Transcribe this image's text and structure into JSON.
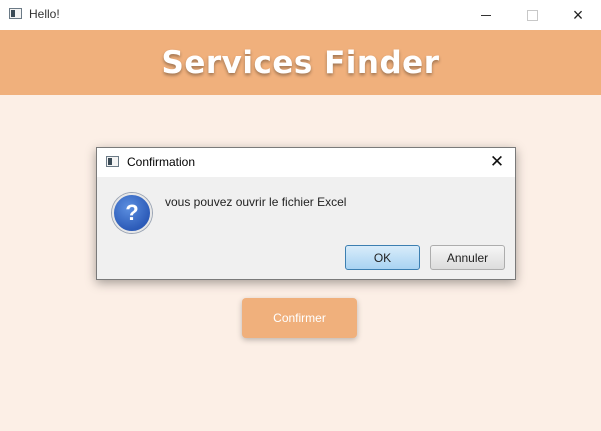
{
  "window": {
    "title": "Hello!",
    "controls": {
      "minimize": "minimize-icon",
      "maximize": "maximize-icon",
      "close": "×"
    }
  },
  "header": {
    "title": "Services Finder",
    "background": "#f0b07c",
    "text_color": "#ffffff"
  },
  "body": {
    "background": "#fcefe6",
    "confirm_label": "Confirmer"
  },
  "dialog": {
    "title": "Confirmation",
    "close": "✕",
    "icon": "question-icon",
    "icon_glyph": "?",
    "message": "vous pouvez ouvrir le fichier Excel",
    "ok_label": "OK",
    "cancel_label": "Annuler"
  }
}
